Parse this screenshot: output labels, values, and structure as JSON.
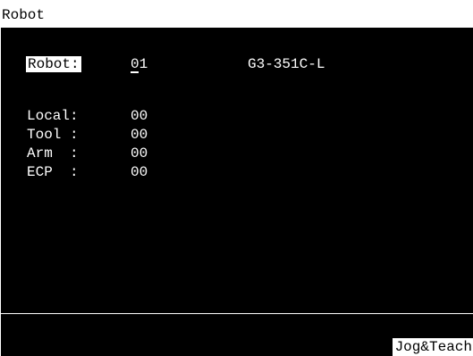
{
  "window": {
    "title": "Robot"
  },
  "robot": {
    "label": "Robot:",
    "number": "01",
    "model": "G3-351C-L"
  },
  "settings": [
    {
      "label": "Local:",
      "value": "00"
    },
    {
      "label": "Tool :",
      "value": "00"
    },
    {
      "label": "Arm  :",
      "value": "00"
    },
    {
      "label": "ECP  :",
      "value": "00"
    }
  ],
  "softkeys": {
    "jog_teach": "Jog&Teach"
  },
  "colors": {
    "screen_background": "#000000",
    "text": "#ffffff",
    "inverse_background": "#ffffff",
    "inverse_text": "#000000"
  }
}
